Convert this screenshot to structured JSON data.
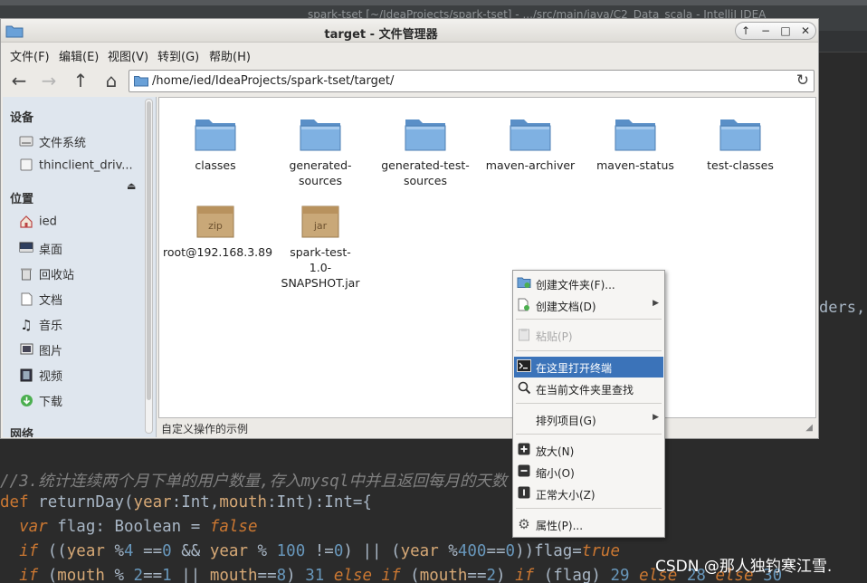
{
  "ide": {
    "title": "spark-tset [~/IdeaProjects/spark-tset] - .../src/main/java/C2_Data_scala - IntelliJ IDEA",
    "fragment": "ders,",
    "code": {
      "line1_comment": "//3.统计连续两个月下单的用户数量,存入mysql中并且返回每月的天数",
      "line2": [
        "def",
        " ",
        "returnDay",
        "(",
        "year",
        ":Int,",
        "mouth",
        ":Int):Int={"
      ],
      "line3": [
        "  ",
        "var",
        " flag: Boolean = ",
        "false"
      ],
      "line4": [
        "  ",
        "if",
        " ((",
        "year",
        " %",
        "4",
        " ==",
        "0",
        " && ",
        "year",
        " % ",
        "100",
        " !=",
        "0",
        ") || (",
        "year",
        " %",
        "400",
        "==",
        "0",
        "))flag=",
        "true"
      ],
      "line5": [
        "  ",
        "if",
        " (",
        "mouth",
        " % ",
        "2",
        "==",
        "1",
        " || ",
        "mouth",
        "==",
        "8",
        ") ",
        "31",
        " ",
        "else if",
        " (",
        "mouth",
        "==",
        "2",
        ") ",
        "if",
        " (flag) ",
        "29",
        " ",
        "else",
        " ",
        "28",
        " ",
        "else",
        " ",
        "30"
      ]
    }
  },
  "watermark": "CSDN @那人独钓寒江雪.",
  "window": {
    "title": "target - 文件管理器",
    "controls": [
      "↑",
      "−",
      "□",
      "✕"
    ]
  },
  "menubar": {
    "file": "文件(F)",
    "edit": "编辑(E)",
    "view": "视图(V)",
    "go": "转到(G)",
    "help": "帮助(H)"
  },
  "toolbar": {
    "back_icon": "arrow-left-icon",
    "forward_icon": "arrow-right-icon",
    "up_icon": "arrow-up-icon",
    "home_icon": "home-icon",
    "path": "/home/ied/IdeaProjects/spark-tset/target/"
  },
  "sidebar": {
    "devices_header": "设备",
    "devices": [
      {
        "label": "文件系统",
        "icon": "filesystem-icon"
      },
      {
        "label": "thinclient_driv...",
        "icon": "drive-icon"
      }
    ],
    "places_header": "位置",
    "places": [
      {
        "label": "ied",
        "icon": "home-icon"
      },
      {
        "label": "桌面",
        "icon": "desktop-icon"
      },
      {
        "label": "回收站",
        "icon": "trash-icon"
      },
      {
        "label": "文档",
        "icon": "document-icon"
      },
      {
        "label": "音乐",
        "icon": "music-icon"
      },
      {
        "label": "图片",
        "icon": "picture-icon"
      },
      {
        "label": "视频",
        "icon": "video-icon"
      },
      {
        "label": "下载",
        "icon": "download-icon"
      }
    ],
    "network_header": "网络"
  },
  "files": [
    {
      "name": "classes",
      "type": "folder"
    },
    {
      "name": "generated-sources",
      "type": "folder"
    },
    {
      "name": "generated-test-sources",
      "type": "folder"
    },
    {
      "name": "maven-archiver",
      "type": "folder"
    },
    {
      "name": "maven-status",
      "type": "folder"
    },
    {
      "name": "test-classes",
      "type": "folder"
    },
    {
      "name": "root@192.168.3.89",
      "type": "archive",
      "badge": "zip"
    },
    {
      "name": "spark-test-1.0-SNAPSHOT.jar",
      "type": "archive",
      "badge": "jar"
    }
  ],
  "status": {
    "text": "自定义操作的示例"
  },
  "context_menu": {
    "items": [
      {
        "label": "创建文件夹(F)...",
        "icon": "new-folder-icon"
      },
      {
        "label": "创建文档(D)",
        "icon": "new-document-icon",
        "submenu": true
      },
      {
        "label": "粘贴(P)",
        "icon": "paste-icon",
        "disabled": true
      },
      {
        "label": "在这里打开终端",
        "icon": "terminal-icon",
        "selected": true
      },
      {
        "label": "在当前文件夹里查找",
        "icon": "search-icon"
      },
      {
        "label": "排列项目(G)",
        "submenu": true
      },
      {
        "label": "放大(N)",
        "icon": "zoom-in-icon"
      },
      {
        "label": "缩小(O)",
        "icon": "zoom-out-icon"
      },
      {
        "label": "正常大小(Z)",
        "icon": "zoom-normal-icon"
      },
      {
        "label": "属性(P)...",
        "icon": "properties-icon"
      }
    ]
  },
  "colors": {
    "selection": "#3b73b9",
    "sidebar": "#dfe6ee",
    "folder": "#6aa1d8"
  }
}
